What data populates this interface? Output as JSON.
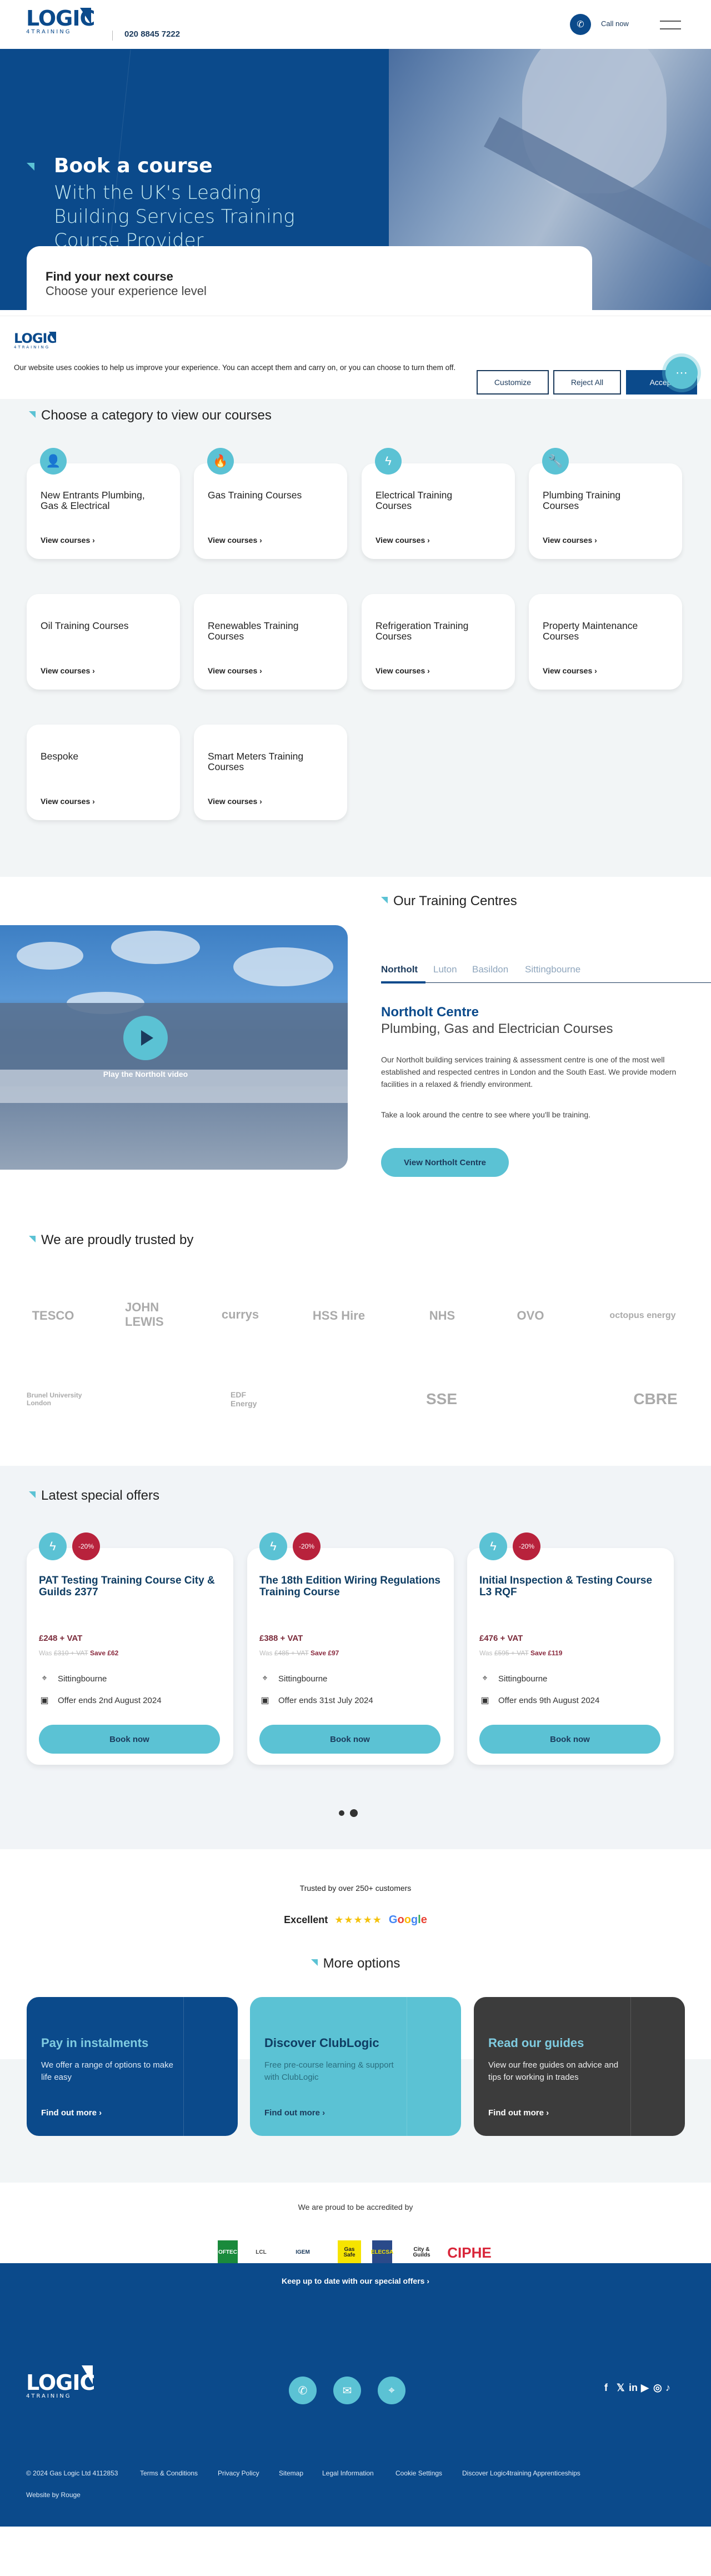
{
  "header": {
    "brand_line1": "LOGIC",
    "brand_line2": "4TRAINING",
    "phone": "020 8845 7222",
    "call_label": "Call now",
    "menu_icon": "hamburger-icon"
  },
  "hero": {
    "title": "Book a course",
    "subtitle": "With the UK's Leading Building Services Training Course Provider",
    "finder_title": "Find your next course",
    "finder_subtitle": "Choose your experience level"
  },
  "cookie_banner": {
    "brand_line1": "LOGIC",
    "brand_line2": "4TRAINING",
    "text": "Our website uses cookies to help us improve your experience. You can accept them and carry on, or you can choose to turn them off.",
    "customize": "Customize",
    "reject": "Reject All",
    "accept": "Accept",
    "chat_icon": "⋯"
  },
  "categories": {
    "title": "Choose a category to view our courses",
    "link_label": "View courses ›",
    "items": [
      {
        "title": "New Entrants Plumbing, Gas & Electrical",
        "icon": "👤"
      },
      {
        "title": "Gas Training Courses",
        "icon": "🔥"
      },
      {
        "title": "Electrical Training Courses",
        "icon": "ϟ"
      },
      {
        "title": "Plumbing Training Courses",
        "icon": "🔧"
      },
      {
        "title": "Oil Training Courses",
        "icon": ""
      },
      {
        "title": "Renewables Training Courses",
        "icon": ""
      },
      {
        "title": "Refrigeration Training Courses",
        "icon": ""
      },
      {
        "title": "Property Maintenance Courses",
        "icon": ""
      },
      {
        "title": "Bespoke",
        "icon": ""
      },
      {
        "title": "Smart Meters Training Courses",
        "icon": ""
      }
    ]
  },
  "centres": {
    "title": "Our Training Centres",
    "tabs": [
      "Northolt",
      "Luton",
      "Basildon",
      "Sittingbourne"
    ],
    "active_tab": "Northolt",
    "play_label": "Play the Northolt video",
    "name": "Northolt Centre",
    "subtitle": "Plumbing, Gas and Electrician Courses",
    "description": "Our Northolt building services training & assessment centre is one of the most well established and respected centres in London and the South East. We provide modern facilities in a relaxed & friendly environment.",
    "description2": "Take a look around the centre to see where you'll be training.",
    "button": "View Northolt Centre"
  },
  "trusted": {
    "title": "We are proudly trusted by",
    "logos": [
      "TESCO",
      "JOHN LEWIS",
      "currys",
      "HSS Hire",
      "NHS",
      "OVO",
      "octopus energy",
      "Brunel University London",
      "EDF Energy",
      "SSE",
      "CBRE"
    ]
  },
  "offers": {
    "title": "Latest special offers",
    "book_label": "Book now",
    "items": [
      {
        "title": "PAT Testing Training Course City & Guilds 2377",
        "discount": "-20%",
        "price": "£248 + VAT",
        "was": "£310 + VAT",
        "was_prefix": "Was",
        "save": "Save £62",
        "location": "Sittingbourne",
        "ends": "Offer ends 2nd August 2024"
      },
      {
        "title": "The 18th Edition Wiring Regulations Training Course",
        "discount": "-20%",
        "price": "£388 + VAT",
        "was": "£485 + VAT",
        "was_prefix": "Was",
        "save": "Save £97",
        "location": "Sittingbourne",
        "ends": "Offer ends 31st July 2024"
      },
      {
        "title": "Initial Inspection & Testing Course L3 RQF",
        "discount": "-20%",
        "price": "£476 + VAT",
        "was": "£595 + VAT",
        "was_prefix": "Was",
        "save": "Save £119",
        "location": "Sittingbourne",
        "ends": "Offer ends 9th August 2024"
      }
    ],
    "carousel_pages": 2,
    "carousel_active": 2
  },
  "reviews": {
    "trusted_text": "Trusted by over 250+ customers",
    "rating_label": "Excellent",
    "stars": 5,
    "provider": "Google"
  },
  "more_options": {
    "title": "More options",
    "link_label": "Find out more ›",
    "items": [
      {
        "title": "Pay in instalments",
        "desc": "We offer a range of options to make life easy",
        "bg": "#0b4a8b",
        "title_color": "#7fcbe0",
        "text_color": "#dfeaf6"
      },
      {
        "title": "Discover ClubLogic",
        "desc": "Free pre-course learning & support with ClubLogic",
        "bg": "#5bc2d4",
        "title_color": "#0f3d63",
        "text_color": "#2a6f80"
      },
      {
        "title": "Read our guides",
        "desc": "View our free guides on advice and tips for working in trades",
        "bg": "#3c3c3c",
        "title_color": "#7fcbe0",
        "text_color": "#eee"
      }
    ]
  },
  "accreditation": {
    "title": "We are proud to be accredited by",
    "logos": [
      "OFTEC",
      "LCL",
      "IGEM",
      "Gas Safe",
      "ELECSA",
      "City & Guilds",
      "CIPHE"
    ]
  },
  "newsletter": {
    "label": "Keep up to date with our special offers ›"
  },
  "footer": {
    "brand_line1": "LOGIC",
    "brand_line2": "4TRAINING",
    "contact_icons": [
      "phone-icon",
      "email-icon",
      "location-icon"
    ],
    "social": [
      "f",
      "𝕏",
      "in",
      "▶",
      "◎",
      "♪"
    ],
    "copyright": "© 2024 Gas Logic Ltd 4112853",
    "links": [
      "Terms & Conditions",
      "Privacy Policy",
      "Sitemap",
      "Legal Information",
      "Cookie Settings",
      "Discover Logic4training Apprenticeships"
    ],
    "credit": "Website by Rouge"
  },
  "colors": {
    "brand_blue": "#0b4a8b",
    "accent_teal": "#5bc2d4",
    "sale_red": "#b8223c"
  }
}
